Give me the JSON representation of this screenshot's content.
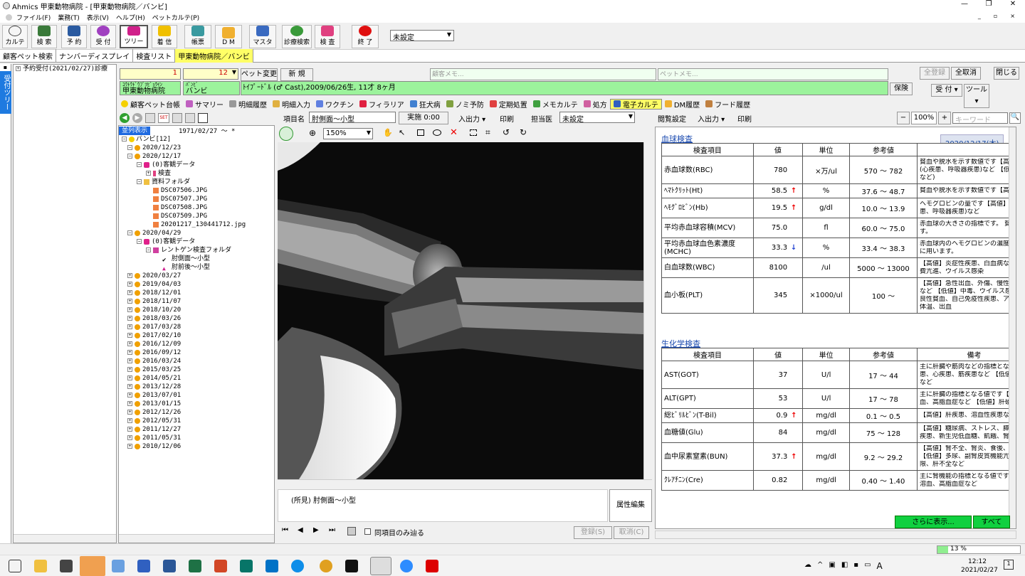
{
  "app": {
    "title": "Ahmics 甲東動物病院 - [甲東動物病院／バンビ]"
  },
  "menu": [
    "ファイル(F)",
    "業務(T)",
    "表示(V)",
    "ヘルプ(H)",
    "ペットカルテ(P)"
  ],
  "toolbar": {
    "buttons": [
      "カルテ",
      "検 索",
      "予 約",
      "受 付",
      "ツリー",
      "着 信",
      "帳票",
      "D M",
      "マスタ",
      "診療検索",
      "検 査",
      "終 了"
    ],
    "setting": "未設定"
  },
  "doc_tabs": [
    "顧客ペット検索",
    "ナンバーディスプレイ",
    "検査リスト",
    "甲東動物病院／バンビ"
  ],
  "side_tab": "受付ツリー",
  "left_tree": {
    "item": "予約受付(2021/02/27)診療"
  },
  "customer": {
    "no": "1",
    "pet_no": "12",
    "pet_change": "ペット変更",
    "new": "新 規",
    "kana": "ｺｳﾄｳﾄﾞｳﾌﾞﾂﾋﾞｮｳｲﾝ",
    "name": "甲東動物病院",
    "pet_kana": "ﾊﾞﾝﾋﾞ",
    "pet_name": "バンビ",
    "client_memo": "顧客メモ...",
    "pet_memo": "ペットメモ...",
    "pet_info": "ﾄｲﾌﾟｰﾄﾞﾙ (♂ Cast),2009/06/26生, 11才 8ヶ月",
    "insurance": "保険"
  },
  "right_buttons": {
    "register_all": "全登録",
    "cancel_all": "全取消",
    "close": "閉じる",
    "reception": "受 付",
    "tools": "ツール"
  },
  "feature_tabs": [
    "顧客ペット台帳",
    "サマリー",
    "明細履歴",
    "明細入力",
    "ワクチン",
    "フィラリア",
    "狂犬病",
    "ノミ予防",
    "定期処置",
    "メモカルテ",
    "処方",
    "電子カルテ",
    "DM履歴",
    "フード履歴"
  ],
  "feature_tab_active": "電子カルテ",
  "history": {
    "mode": "並列表示",
    "date_range": "1971/02/27 〜 *",
    "root": "バンビ[12]",
    "nodes": [
      {
        "t": "2020/12/23",
        "d": 0,
        "k": "date"
      },
      {
        "t": "2020/12/17",
        "d": 0,
        "k": "date"
      },
      {
        "t": "(0)客観データ",
        "d": 1,
        "k": "cam"
      },
      {
        "t": "検査",
        "d": 2,
        "k": "test"
      },
      {
        "t": "資料フォルダ",
        "d": 1,
        "k": "folder"
      },
      {
        "t": "DSC07506.JPG",
        "d": 2,
        "k": "img"
      },
      {
        "t": "DSC07507.JPG",
        "d": 2,
        "k": "img"
      },
      {
        "t": "DSC07508.JPG",
        "d": 2,
        "k": "img"
      },
      {
        "t": "DSC07509.JPG",
        "d": 2,
        "k": "img"
      },
      {
        "t": "20201217_130441712.jpg",
        "d": 2,
        "k": "img"
      },
      {
        "t": "2020/04/29",
        "d": 0,
        "k": "date"
      },
      {
        "t": "(0)客観データ",
        "d": 1,
        "k": "cam"
      },
      {
        "t": "レントゲン検査フォルダ",
        "d": 2,
        "k": "xfolder"
      },
      {
        "t": "肘側面〜小型",
        "d": 3,
        "k": "check"
      },
      {
        "t": "肘前後〜小型",
        "d": 3,
        "k": "tri"
      },
      {
        "t": "2020/03/27",
        "d": 0,
        "k": "date"
      },
      {
        "t": "2019/04/03",
        "d": 0,
        "k": "date"
      },
      {
        "t": "2018/12/01",
        "d": 0,
        "k": "date"
      },
      {
        "t": "2018/11/07",
        "d": 0,
        "k": "date"
      },
      {
        "t": "2018/10/20",
        "d": 0,
        "k": "date"
      },
      {
        "t": "2018/03/26",
        "d": 0,
        "k": "date"
      },
      {
        "t": "2017/03/28",
        "d": 0,
        "k": "date"
      },
      {
        "t": "2017/02/10",
        "d": 0,
        "k": "date"
      },
      {
        "t": "2016/12/09",
        "d": 0,
        "k": "date"
      },
      {
        "t": "2016/09/12",
        "d": 0,
        "k": "date"
      },
      {
        "t": "2016/03/24",
        "d": 0,
        "k": "date"
      },
      {
        "t": "2015/03/25",
        "d": 0,
        "k": "date"
      },
      {
        "t": "2014/05/21",
        "d": 0,
        "k": "date"
      },
      {
        "t": "2013/12/28",
        "d": 0,
        "k": "date"
      },
      {
        "t": "2013/07/01",
        "d": 0,
        "k": "date"
      },
      {
        "t": "2013/01/15",
        "d": 0,
        "k": "date"
      },
      {
        "t": "2012/12/26",
        "d": 0,
        "k": "date"
      },
      {
        "t": "2012/05/31",
        "d": 0,
        "k": "date"
      },
      {
        "t": "2011/12/27",
        "d": 0,
        "k": "date"
      },
      {
        "t": "2011/05/31",
        "d": 0,
        "k": "date"
      },
      {
        "t": "2010/12/06",
        "d": 0,
        "k": "date"
      }
    ]
  },
  "viewer": {
    "item_label": "項目名",
    "item_name": "肘側面〜小型",
    "time": "実施 0:00",
    "io": "入出力",
    "print": "印刷",
    "doctor_label": "担当医",
    "doctor": "未設定",
    "zoom": "150%",
    "findings": "(所見)  肘側面〜小型",
    "attr_edit": "属性編集",
    "same_item": "同項目のみ辿る",
    "register": "登録(S)",
    "cancel": "取消(C)"
  },
  "report": {
    "settings": "閲覧設定",
    "io": "入出力",
    "print": "印刷",
    "zoom": "100%",
    "keyword": "キーワード",
    "date": "2020/12/17(木)",
    "more": "さらに表示...",
    "all": "すべて",
    "sections": [
      {
        "title": "血球検査",
        "headers": [
          "検査項目",
          "値",
          "単位",
          "参考値",
          ""
        ],
        "rows": [
          [
            "赤血球数(RBC)",
            "780",
            "",
            "×万/ul",
            "570 〜 782",
            "貧血や脱水を示す数値です【高値】脱水、多血症|(心疾患、呼吸器疾患)など 【低値】貧血|など)"
          ],
          [
            "ﾍﾏﾄｸﾘｯﾄ(Ht)",
            "58.5",
            "up",
            "%",
            "37.6 〜 48.7",
            "貧血や脱水を示す数値です【高値】脱水"
          ],
          [
            "ﾍﾓｸﾞﾛﾋﾞﾝ(Hb)",
            "19.5",
            "up",
            "g/dl",
            "10.0 〜 13.9",
            "ヘモグロビンの量です【高値】脱水、ニ|患、呼吸器疾患)など"
          ],
          [
            "平均赤血球容積(MCV)",
            "75.0",
            "",
            "fl",
            "60.0 〜 75.0",
            "赤血球の大きさの指標です。 貧血の|す。"
          ],
          [
            "平均赤血球血色素濃度(MCHC)",
            "33.3",
            "down",
            "%",
            "33.4 〜 38.3",
            "赤血球内のヘモグロビンの濃度です。|に用います。"
          ],
          [
            "白血球数(WBC)",
            "8100",
            "",
            "/ul",
            "5000 〜 13000",
            "【高値】炎症性疾患、白血病など 【|費亢進、ウイルス感染"
          ],
          [
            "血小板(PLT)",
            "345",
            "",
            "×1000/ul",
            "100 〜",
            "【高値】急性出血、外傷、慢性感染症、|など 【低値】中毒、ウイルス感染、骨|良性貧血、自己免疫性疾患、アナフィ|体温、出血"
          ]
        ]
      },
      {
        "title": "生化学検査",
        "headers": [
          "検査項目",
          "値",
          "単位",
          "参考値",
          "備考"
        ],
        "rows": [
          [
            "AST(GOT)",
            "37",
            "",
            "U/l",
            "17 〜 44",
            "主に肝臓や筋肉などの指標となる値|患、心疾患、筋疾患など 【低値】肝硬|など"
          ],
          [
            "ALT(GPT)",
            "53",
            "",
            "U/l",
            "17 〜 78",
            "主に肝臓の指標となる値です【高値】|血、高脂血症など 【低値】肝硬変、門"
          ],
          [
            "総ﾋﾞﾘﾙﾋﾞﾝ(T-Bil)",
            "0.9",
            "up",
            "mg/dl",
            "0.1 〜 0.5",
            "【高値】肝疾患、溶血性疾患など"
          ],
          [
            "血糖値(Glu)",
            "84",
            "",
            "mg/dl",
            "75 〜 128",
            "【高値】糖尿病、ストレス、膵炎、腎障|疾患、新生児低血糖、飢餓、腎不全、"
          ],
          [
            "血中尿素窒素(BUN)",
            "37.3",
            "up",
            "mg/dl",
            "9.2 〜 29.2",
            "【高値】腎不全、腎炎、食後、消化管|【低値】多尿、副腎皮質機能亢進症、|限、肝不全など"
          ],
          [
            "ｸﾚｱﾁﾆﾝ(Cre)",
            "0.82",
            "",
            "mg/dl",
            "0.40 〜 1.40",
            "主に腎機能の指標となる値です【高値|溶血、高脂血症など"
          ]
        ]
      }
    ]
  },
  "status": {
    "percent": "13 %"
  },
  "taskbar": {
    "time": "12:12",
    "date": "2021/02/27",
    "ime": "A"
  }
}
